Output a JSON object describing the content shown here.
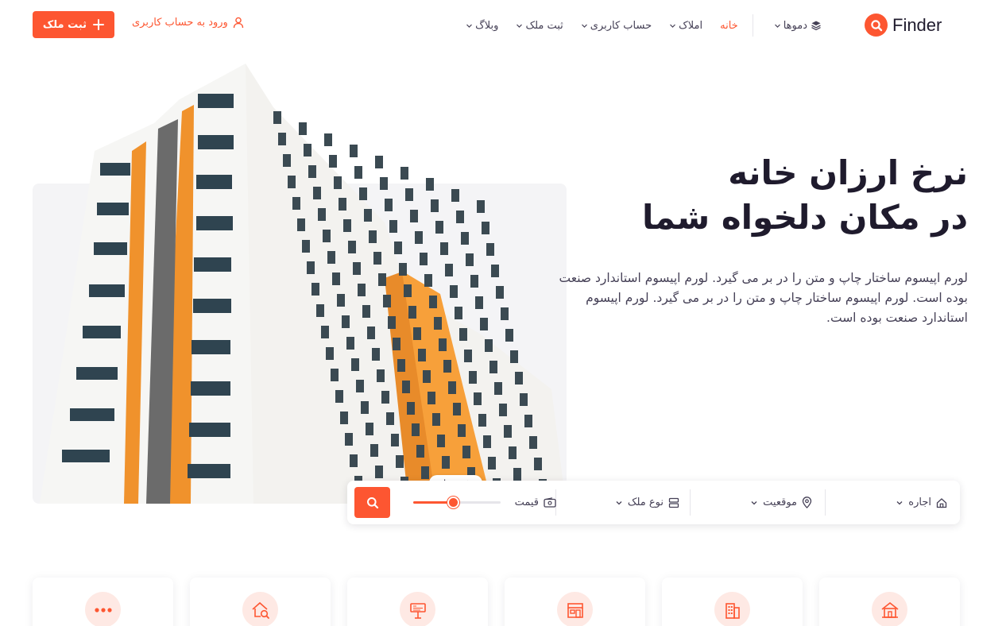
{
  "brand": {
    "name": "Finder",
    "accent": "#fd5631"
  },
  "nav": {
    "items": [
      {
        "label": "دموها",
        "icon": "layers-icon"
      },
      {
        "label": "خانه",
        "active": true
      },
      {
        "label": "املاک"
      },
      {
        "label": "حساب کاربری"
      },
      {
        "label": "ثبت ملک"
      },
      {
        "label": "وبلاگ"
      }
    ]
  },
  "header": {
    "login_label": "ورود به حساب کاربری",
    "cta_label": "ثبت ملک"
  },
  "hero": {
    "title_line1": "نرخ ارزان خانه",
    "title_line2": "در مکان دلخواه شما",
    "description": "لورم اپیسوم ساختار چاپ و متن را در بر می گیرد. لورم اپیسوم استاندارد صنعت بوده است. لورم اپیسوم ساختار چاپ و متن را در بر می گیرد. لورم اپیسوم استاندارد صنعت بوده است."
  },
  "search": {
    "deal_type": "اجاره",
    "location": "موقعیت",
    "property_type": "نوع ملک",
    "price_label": "قیمت",
    "price_tooltip": "۴۵۰ تومان",
    "price_fraction": 0.45
  },
  "categories": [
    {
      "icon": "house-icon"
    },
    {
      "icon": "building-icon"
    },
    {
      "icon": "storefront-icon"
    },
    {
      "icon": "rent-sign-icon"
    },
    {
      "icon": "house-search-icon"
    },
    {
      "icon": "more-icon"
    }
  ]
}
